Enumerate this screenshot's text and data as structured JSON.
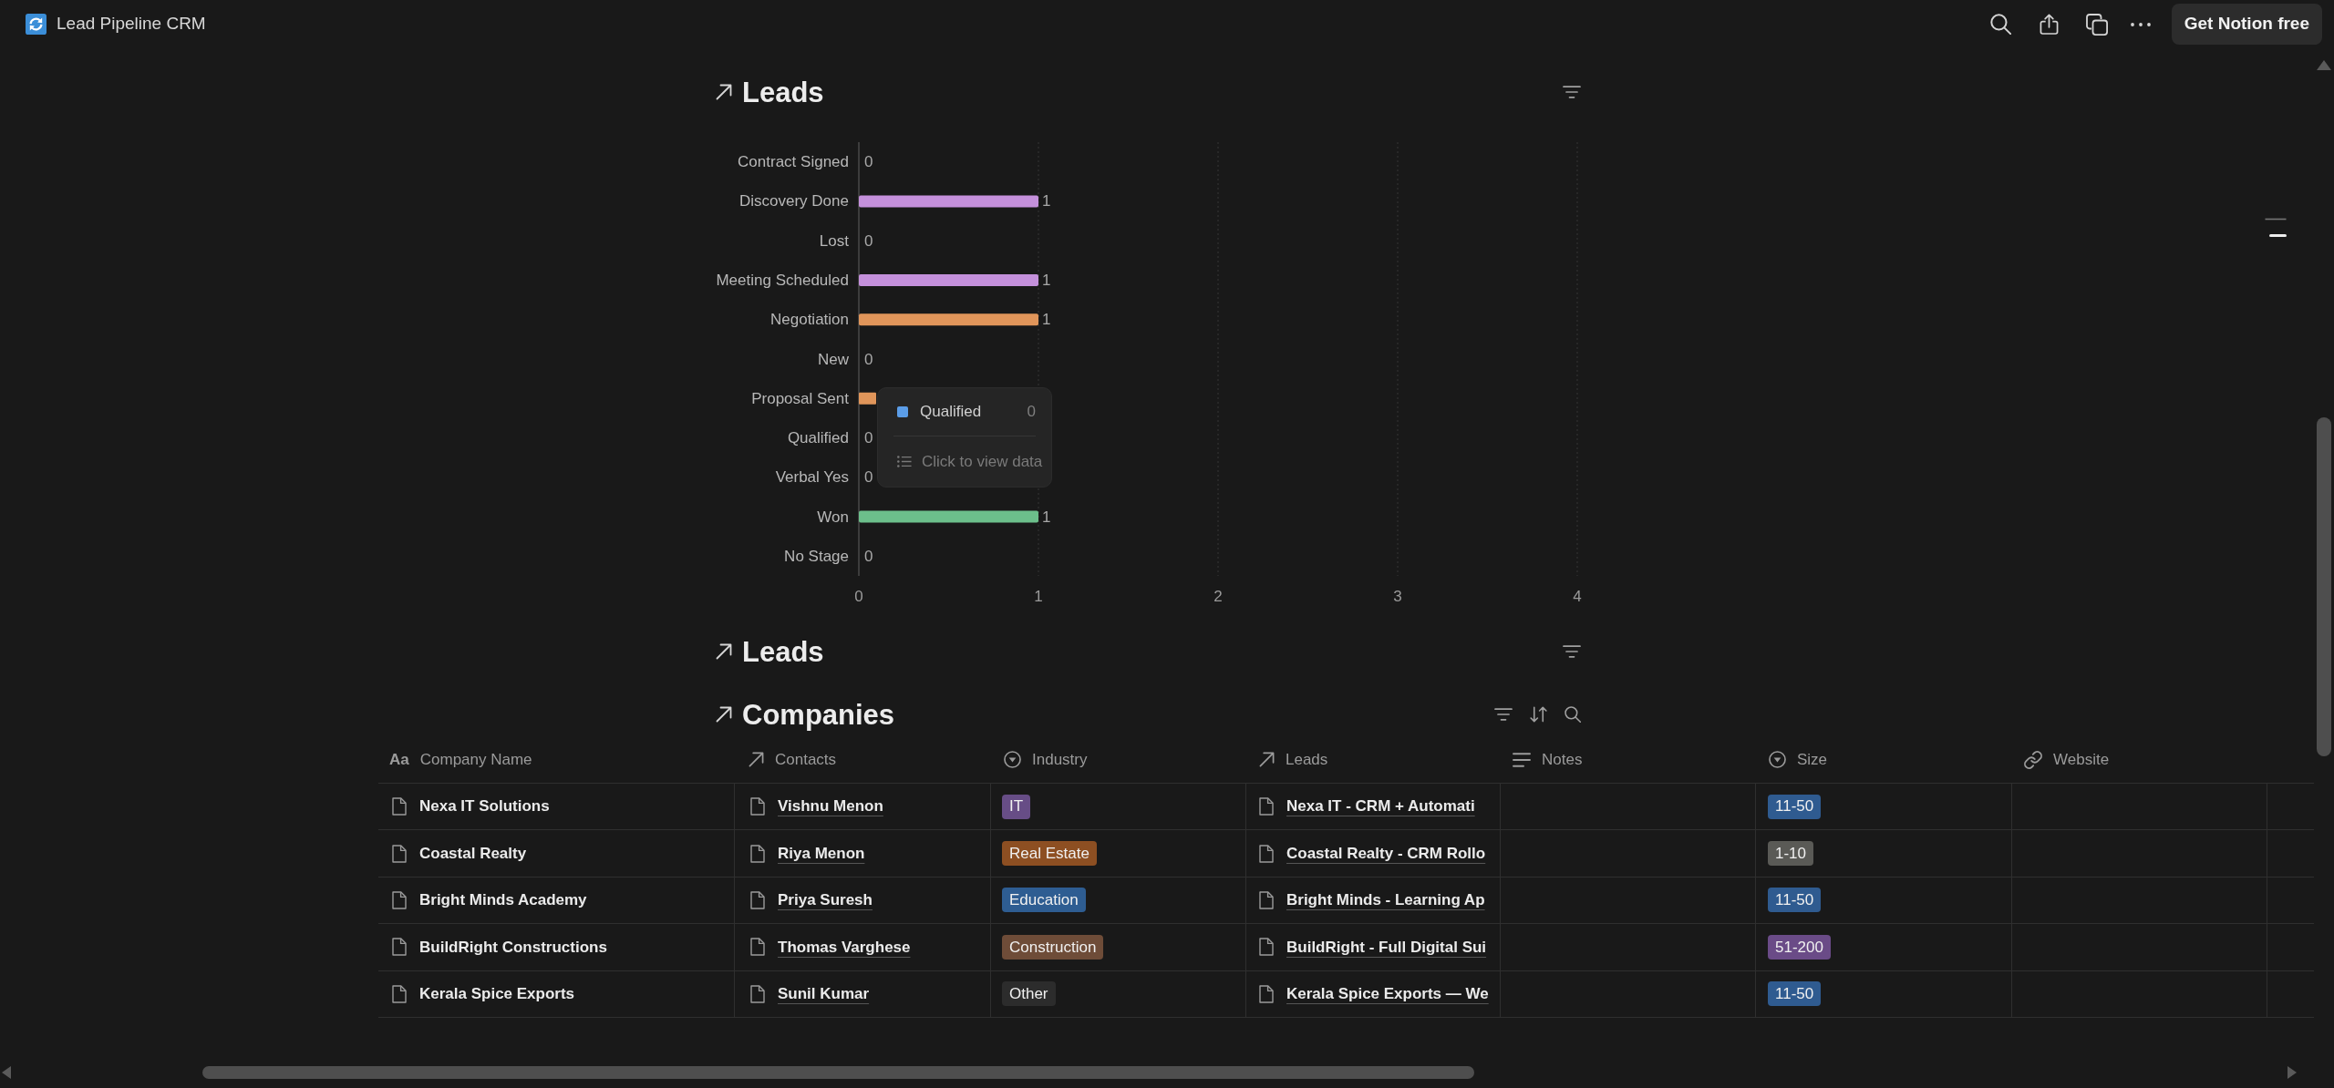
{
  "topbar": {
    "title": "Lead Pipeline CRM",
    "button": "Get Notion free"
  },
  "sections": [
    {
      "kind": "chart",
      "title": "Leads",
      "chart_data": {
        "type": "bar",
        "orientation": "horizontal",
        "categories": [
          "Contract Signed",
          "Discovery Done",
          "Lost",
          "Meeting Scheduled",
          "Negotiation",
          "New",
          "Proposal Sent",
          "Qualified",
          "Verbal Yes",
          "Won",
          "No Stage"
        ],
        "values": [
          0,
          1,
          0,
          1,
          1,
          0,
          null,
          0,
          0,
          1,
          0
        ],
        "colors": [
          null,
          "#c490db",
          null,
          "#c490db",
          "#e0955a",
          null,
          "#e0955a",
          null,
          null,
          "#6cbf8b",
          null
        ],
        "value_labels": [
          "0",
          "1",
          "0",
          "1",
          "1",
          "0",
          null,
          "0",
          "0",
          "1",
          "0"
        ],
        "xlim": [
          0,
          4
        ],
        "xticks": [
          0,
          1,
          2,
          3,
          4
        ],
        "grid": true
      },
      "tooltip": {
        "label": "Qualified",
        "color": "#5b9de8",
        "value": "0",
        "action": "Click to view data"
      }
    },
    {
      "kind": "empty",
      "title": "Leads"
    },
    {
      "kind": "table",
      "title": "Companies",
      "table": {
        "columns": [
          {
            "label": "Company Name",
            "kind": "title",
            "icon": "Aa"
          },
          {
            "label": "Contacts",
            "kind": "relation"
          },
          {
            "label": "Industry",
            "kind": "select"
          },
          {
            "label": "Leads",
            "kind": "relation"
          },
          {
            "label": "Notes",
            "kind": "text"
          },
          {
            "label": "Size",
            "kind": "select"
          },
          {
            "label": "Website",
            "kind": "url"
          }
        ],
        "rows": [
          {
            "cells": [
              "Nexa IT Solutions",
              "Vishnu Menon",
              {
                "label": "IT",
                "color": "#674d86"
              },
              "Nexa IT - CRM + Automati",
              null,
              {
                "label": "11-50",
                "color": "#2f5b90"
              },
              null
            ]
          },
          {
            "cells": [
              "Coastal Realty",
              "Riya Menon",
              {
                "label": "Real Estate",
                "color": "#8d4f22"
              },
              "Coastal Realty - CRM Rollo",
              null,
              {
                "label": "1-10",
                "color": "#5a5a56"
              },
              null
            ]
          },
          {
            "cells": [
              "Bright Minds Academy",
              "Priya Suresh",
              {
                "label": "Education",
                "color": "#2e5d92"
              },
              "Bright Minds - Learning Ap",
              null,
              {
                "label": "11-50",
                "color": "#2f5b90"
              },
              null
            ]
          },
          {
            "cells": [
              "BuildRight Constructions",
              "Thomas Varghese",
              {
                "label": "Construction",
                "color": "#6e4c38"
              },
              "BuildRight - Full Digital Sui",
              null,
              {
                "label": "51-200",
                "color": "#6a4b87"
              },
              null
            ]
          },
          {
            "cells": [
              "Kerala Spice Exports",
              "Sunil Kumar",
              {
                "label": "Other",
                "color": "#2c2c2c"
              },
              "Kerala Spice Exports — We",
              null,
              {
                "label": "11-50",
                "color": "#2f5b90"
              },
              null
            ]
          }
        ]
      }
    }
  ]
}
